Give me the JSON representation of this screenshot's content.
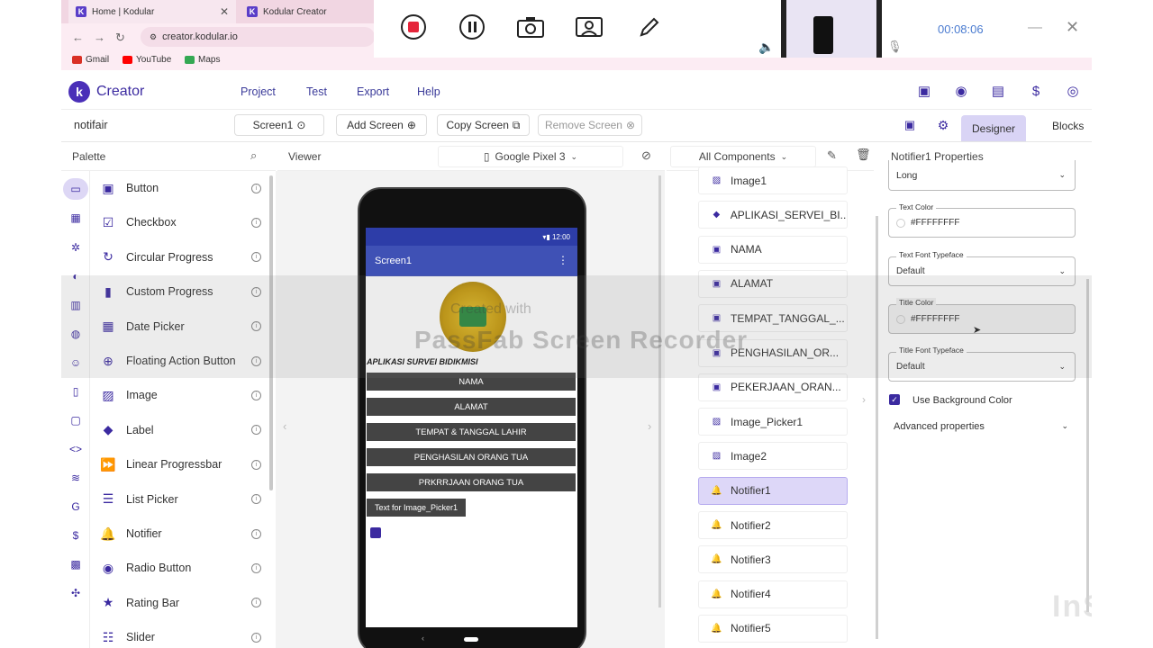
{
  "browser": {
    "tabs": [
      {
        "title": "Home | Kodular",
        "active": true
      },
      {
        "title": "Kodular Creator",
        "active": false
      }
    ],
    "url": "creator.kodular.io",
    "bookmarks": [
      {
        "label": "Gmail",
        "color": "#d93025"
      },
      {
        "label": "YouTube",
        "color": "#ff0000"
      },
      {
        "label": "Maps",
        "color": "#34a853"
      }
    ]
  },
  "recorder": {
    "timer": "00:08:06",
    "watermark_small": "Created with",
    "watermark_big": "PassFab Screen Recorder"
  },
  "app": {
    "brand": "Creator",
    "menu": [
      "Project",
      "Test",
      "Export",
      "Help"
    ],
    "project_name": "notifair",
    "screen_select": "Screen1",
    "add_screen": "Add Screen",
    "copy_screen": "Copy Screen",
    "remove_screen": "Remove Screen",
    "designer": "Designer",
    "blocks": "Blocks"
  },
  "palette": {
    "title": "Palette",
    "items": [
      {
        "label": "Button",
        "icon": "button-icon"
      },
      {
        "label": "Checkbox",
        "icon": "checkbox-icon"
      },
      {
        "label": "Circular Progress",
        "icon": "circular-progress-icon"
      },
      {
        "label": "Custom Progress",
        "icon": "custom-progress-icon"
      },
      {
        "label": "Date Picker",
        "icon": "calendar-icon"
      },
      {
        "label": "Floating Action Button",
        "icon": "plus-circle-icon"
      },
      {
        "label": "Image",
        "icon": "image-icon"
      },
      {
        "label": "Label",
        "icon": "label-icon"
      },
      {
        "label": "Linear Progressbar",
        "icon": "fast-forward-icon"
      },
      {
        "label": "List Picker",
        "icon": "list-icon"
      },
      {
        "label": "Notifier",
        "icon": "bell-icon"
      },
      {
        "label": "Radio Button",
        "icon": "radio-icon"
      },
      {
        "label": "Rating Bar",
        "icon": "star-icon"
      },
      {
        "label": "Slider",
        "icon": "slider-icon"
      }
    ]
  },
  "viewer": {
    "title": "Viewer",
    "device": "Google Pixel 3",
    "phone": {
      "time": "12:00",
      "screen_title": "Screen1",
      "survey_title": "APLIKASI SURVEI BIDIKMISI",
      "buttons": [
        "NAMA",
        "ALAMAT",
        "TEMPAT & TANGGAL LAHIR",
        "PENGHASILAN ORANG TUA",
        "PRKRRJAAN ORANG TUA"
      ],
      "image_picker": "Text for Image_Picker1"
    }
  },
  "components": {
    "filter": "All Components",
    "items": [
      {
        "label": "Image1",
        "icon": "image-icon",
        "selected": false
      },
      {
        "label": "APLIKASI_SERVEI_BI...",
        "icon": "label-icon",
        "selected": false
      },
      {
        "label": "NAMA",
        "icon": "button-icon",
        "selected": false
      },
      {
        "label": "ALAMAT",
        "icon": "button-icon",
        "selected": false
      },
      {
        "label": "TEMPAT_TANGGAL_...",
        "icon": "button-icon",
        "selected": false
      },
      {
        "label": "PENGHASILAN_OR...",
        "icon": "button-icon",
        "selected": false
      },
      {
        "label": "PEKERJAAN_ORAN...",
        "icon": "button-icon",
        "selected": false
      },
      {
        "label": "Image_Picker1",
        "icon": "image-icon",
        "selected": false
      },
      {
        "label": "Image2",
        "icon": "image-icon",
        "selected": false
      },
      {
        "label": "Notifier1",
        "icon": "bell-icon",
        "selected": true
      },
      {
        "label": "Notifier2",
        "icon": "bell-icon",
        "selected": false
      },
      {
        "label": "Notifier3",
        "icon": "bell-icon",
        "selected": false
      },
      {
        "label": "Notifier4",
        "icon": "bell-icon",
        "selected": false
      },
      {
        "label": "Notifier5",
        "icon": "bell-icon",
        "selected": false
      }
    ]
  },
  "properties": {
    "title": "Notifier1 Properties",
    "duration_value": "Long",
    "text_color_label": "Text Color",
    "text_color_value": "#FFFFFFFF",
    "text_font_label": "Text Font Typeface",
    "text_font_value": "Default",
    "title_color_label": "Title Color",
    "title_color_value": "#FFFFFFFF",
    "title_font_label": "Title Font Typeface",
    "title_font_value": "Default",
    "use_bg_label": "Use Background Color",
    "use_bg_checked": true,
    "advanced": "Advanced properties"
  },
  "colors": {
    "accent": "#3b2aa0",
    "selected_bg": "#ddd7f8",
    "phone_appbar": "#3f51b5",
    "phone_button": "#444444"
  }
}
